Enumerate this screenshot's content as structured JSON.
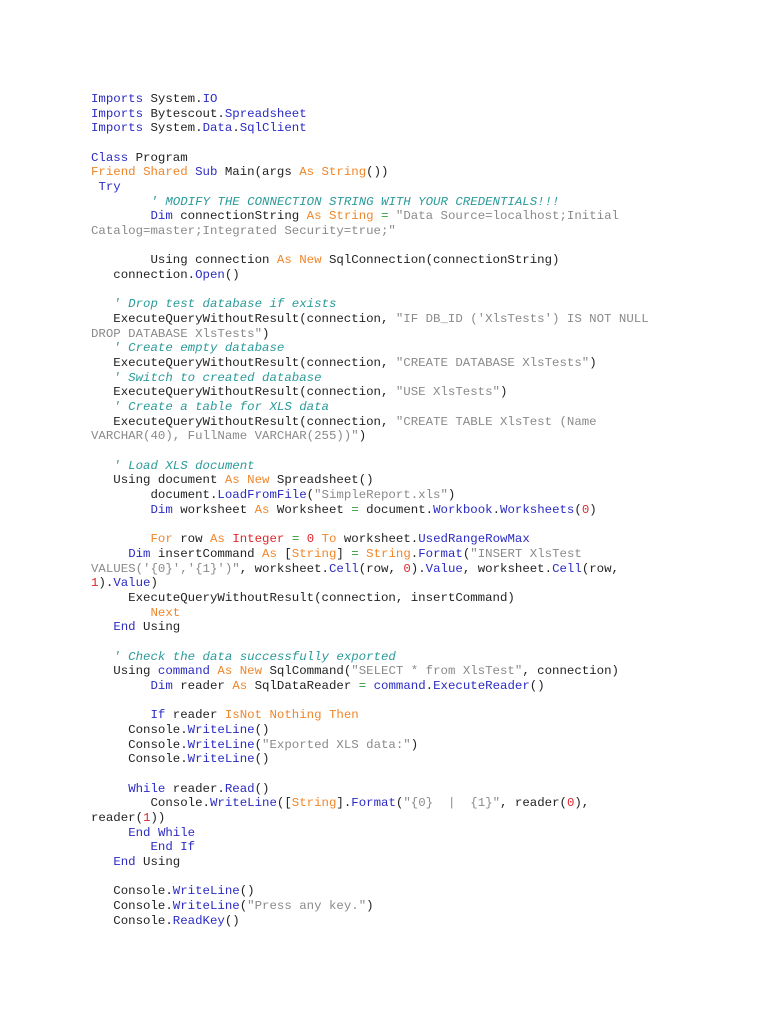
{
  "document": {
    "lines": [
      [
        [
          "Imports",
          "k"
        ],
        [
          " System.",
          "p"
        ],
        [
          "IO",
          "k"
        ]
      ],
      [
        [
          "Imports",
          "k"
        ],
        [
          " Bytescout.",
          "p"
        ],
        [
          "Spreadsheet",
          "k"
        ]
      ],
      [
        [
          "Imports",
          "k"
        ],
        [
          " System.",
          "p"
        ],
        [
          "Data",
          "k"
        ],
        [
          ".",
          "p"
        ],
        [
          "SqlClient",
          "k"
        ]
      ],
      [],
      [
        [
          "Class",
          "k"
        ],
        [
          " Program",
          "p"
        ]
      ],
      [
        [
          "Friend",
          "o"
        ],
        [
          " ",
          "p"
        ],
        [
          "Shared",
          "o"
        ],
        [
          " ",
          "p"
        ],
        [
          "Sub",
          "k"
        ],
        [
          " Main(args ",
          "p"
        ],
        [
          "As",
          "o"
        ],
        [
          " ",
          "p"
        ],
        [
          "String",
          "o"
        ],
        [
          "())",
          "p"
        ]
      ],
      [
        [
          " ",
          "p"
        ],
        [
          "Try",
          "k"
        ]
      ],
      [
        [
          "        ",
          "p"
        ],
        [
          "' MODIFY THE CONNECTION STRING WITH YOUR CREDENTIALS!!!",
          "c"
        ]
      ],
      [
        [
          "        ",
          "p"
        ],
        [
          "Dim",
          "k"
        ],
        [
          " connectionString ",
          "p"
        ],
        [
          "As",
          "o"
        ],
        [
          " ",
          "p"
        ],
        [
          "String",
          "o"
        ],
        [
          " ",
          "p"
        ],
        [
          "=",
          "g"
        ],
        [
          " ",
          "p"
        ],
        [
          "\"Data Source=localhost;Initial",
          "s"
        ]
      ],
      [
        [
          "Catalog=master;Integrated Security=true;\"",
          "s"
        ]
      ],
      [],
      [
        [
          "        Using connection ",
          "p"
        ],
        [
          "As",
          "o"
        ],
        [
          " ",
          "p"
        ],
        [
          "New",
          "o"
        ],
        [
          " SqlConnection(connectionString)",
          "p"
        ]
      ],
      [
        [
          "   connection.",
          "p"
        ],
        [
          "Open",
          "k"
        ],
        [
          "()",
          "p"
        ]
      ],
      [],
      [
        [
          "   ",
          "p"
        ],
        [
          "' Drop test database if exists",
          "c"
        ]
      ],
      [
        [
          "   ExecuteQueryWithoutResult(connection, ",
          "p"
        ],
        [
          "\"IF DB_ID ('XlsTests') IS NOT NULL",
          "s"
        ]
      ],
      [
        [
          "DROP DATABASE XlsTests\"",
          "s"
        ],
        [
          ")",
          "p"
        ]
      ],
      [
        [
          "   ",
          "p"
        ],
        [
          "' Create empty database",
          "c"
        ]
      ],
      [
        [
          "   ExecuteQueryWithoutResult(connection, ",
          "p"
        ],
        [
          "\"CREATE DATABASE XlsTests\"",
          "s"
        ],
        [
          ")",
          "p"
        ]
      ],
      [
        [
          "   ",
          "p"
        ],
        [
          "' Switch to created database",
          "c"
        ]
      ],
      [
        [
          "   ExecuteQueryWithoutResult(connection, ",
          "p"
        ],
        [
          "\"USE XlsTests\"",
          "s"
        ],
        [
          ")",
          "p"
        ]
      ],
      [
        [
          "   ",
          "p"
        ],
        [
          "' Create a table for XLS data",
          "c"
        ]
      ],
      [
        [
          "   ExecuteQueryWithoutResult(connection, ",
          "p"
        ],
        [
          "\"CREATE TABLE XlsTest (Name",
          "s"
        ]
      ],
      [
        [
          "VARCHAR(40), FullName VARCHAR(255))\"",
          "s"
        ],
        [
          ")",
          "p"
        ]
      ],
      [],
      [
        [
          "   ",
          "p"
        ],
        [
          "' Load XLS document",
          "c"
        ]
      ],
      [
        [
          "   Using document ",
          "p"
        ],
        [
          "As",
          "o"
        ],
        [
          " ",
          "p"
        ],
        [
          "New",
          "o"
        ],
        [
          " Spreadsheet()",
          "p"
        ]
      ],
      [
        [
          "        document.",
          "p"
        ],
        [
          "LoadFromFile",
          "k"
        ],
        [
          "(",
          "p"
        ],
        [
          "\"SimpleReport.xls\"",
          "s"
        ],
        [
          ")",
          "p"
        ]
      ],
      [
        [
          "        ",
          "p"
        ],
        [
          "Dim",
          "k"
        ],
        [
          " worksheet ",
          "p"
        ],
        [
          "As",
          "o"
        ],
        [
          " Worksheet ",
          "p"
        ],
        [
          "=",
          "g"
        ],
        [
          " document.",
          "p"
        ],
        [
          "Workbook",
          "k"
        ],
        [
          ".",
          "p"
        ],
        [
          "Worksheets",
          "k"
        ],
        [
          "(",
          "p"
        ],
        [
          "0",
          "r"
        ],
        [
          ")",
          "p"
        ]
      ],
      [],
      [
        [
          "        ",
          "p"
        ],
        [
          "For",
          "o"
        ],
        [
          " row ",
          "p"
        ],
        [
          "As",
          "o"
        ],
        [
          " ",
          "p"
        ],
        [
          "Integer",
          "r"
        ],
        [
          " ",
          "p"
        ],
        [
          "=",
          "g"
        ],
        [
          " ",
          "p"
        ],
        [
          "0",
          "r"
        ],
        [
          " ",
          "p"
        ],
        [
          "To",
          "o"
        ],
        [
          " worksheet.",
          "p"
        ],
        [
          "UsedRangeRowMax",
          "k"
        ]
      ],
      [
        [
          "     ",
          "p"
        ],
        [
          "Dim",
          "k"
        ],
        [
          " insertCommand ",
          "p"
        ],
        [
          "As",
          "o"
        ],
        [
          " [",
          "p"
        ],
        [
          "String",
          "o"
        ],
        [
          "] ",
          "p"
        ],
        [
          "=",
          "g"
        ],
        [
          " ",
          "p"
        ],
        [
          "String",
          "o"
        ],
        [
          ".",
          "p"
        ],
        [
          "Format",
          "k"
        ],
        [
          "(",
          "p"
        ],
        [
          "\"INSERT XlsTest",
          "s"
        ]
      ],
      [
        [
          "VALUES('{0}','{1}')\"",
          "s"
        ],
        [
          ", worksheet.",
          "p"
        ],
        [
          "Cell",
          "k"
        ],
        [
          "(row, ",
          "p"
        ],
        [
          "0",
          "r"
        ],
        [
          ").",
          "p"
        ],
        [
          "Value",
          "k"
        ],
        [
          ", worksheet.",
          "p"
        ],
        [
          "Cell",
          "k"
        ],
        [
          "(row,",
          "p"
        ]
      ],
      [
        [
          "1",
          "r"
        ],
        [
          ").",
          "p"
        ],
        [
          "Value",
          "k"
        ],
        [
          ")",
          "p"
        ]
      ],
      [
        [
          "     ExecuteQueryWithoutResult(connection, insertCommand)",
          "p"
        ]
      ],
      [
        [
          "        ",
          "p"
        ],
        [
          "Next",
          "o"
        ]
      ],
      [
        [
          "   ",
          "p"
        ],
        [
          "End",
          "k"
        ],
        [
          " Using",
          "p"
        ]
      ],
      [],
      [
        [
          "   ",
          "p"
        ],
        [
          "' Check the data successfully exported",
          "c"
        ]
      ],
      [
        [
          "   Using ",
          "p"
        ],
        [
          "command",
          "k"
        ],
        [
          " ",
          "p"
        ],
        [
          "As",
          "o"
        ],
        [
          " ",
          "p"
        ],
        [
          "New",
          "o"
        ],
        [
          " SqlCommand(",
          "p"
        ],
        [
          "\"SELECT * from XlsTest\"",
          "s"
        ],
        [
          ", connection)",
          "p"
        ]
      ],
      [
        [
          "        ",
          "p"
        ],
        [
          "Dim",
          "k"
        ],
        [
          " reader ",
          "p"
        ],
        [
          "As",
          "o"
        ],
        [
          " SqlDataReader ",
          "p"
        ],
        [
          "=",
          "g"
        ],
        [
          " ",
          "p"
        ],
        [
          "command",
          "k"
        ],
        [
          ".",
          "p"
        ],
        [
          "ExecuteReader",
          "k"
        ],
        [
          "()",
          "p"
        ]
      ],
      [],
      [
        [
          "        ",
          "p"
        ],
        [
          "If",
          "k"
        ],
        [
          " reader ",
          "p"
        ],
        [
          "IsNot",
          "o"
        ],
        [
          " ",
          "p"
        ],
        [
          "Nothing",
          "o"
        ],
        [
          " ",
          "p"
        ],
        [
          "Then",
          "o"
        ]
      ],
      [
        [
          "     Console.",
          "p"
        ],
        [
          "WriteLine",
          "k"
        ],
        [
          "()",
          "p"
        ]
      ],
      [
        [
          "     Console.",
          "p"
        ],
        [
          "WriteLine",
          "k"
        ],
        [
          "(",
          "p"
        ],
        [
          "\"Exported XLS data:\"",
          "s"
        ],
        [
          ")",
          "p"
        ]
      ],
      [
        [
          "     Console.",
          "p"
        ],
        [
          "WriteLine",
          "k"
        ],
        [
          "()",
          "p"
        ]
      ],
      [],
      [
        [
          "     ",
          "p"
        ],
        [
          "While",
          "k"
        ],
        [
          " reader.",
          "p"
        ],
        [
          "Read",
          "k"
        ],
        [
          "()",
          "p"
        ]
      ],
      [
        [
          "        Console.",
          "p"
        ],
        [
          "WriteLine",
          "k"
        ],
        [
          "([",
          "p"
        ],
        [
          "String",
          "o"
        ],
        [
          "].",
          "p"
        ],
        [
          "Format",
          "k"
        ],
        [
          "(",
          "p"
        ],
        [
          "\"{0}  |  {1}\"",
          "s"
        ],
        [
          ", reader(",
          "p"
        ],
        [
          "0",
          "r"
        ],
        [
          "),",
          "p"
        ]
      ],
      [
        [
          "reader(",
          "p"
        ],
        [
          "1",
          "r"
        ],
        [
          "))",
          "p"
        ]
      ],
      [
        [
          "     ",
          "p"
        ],
        [
          "End",
          "k"
        ],
        [
          " ",
          "p"
        ],
        [
          "While",
          "k"
        ]
      ],
      [
        [
          "        ",
          "p"
        ],
        [
          "End",
          "k"
        ],
        [
          " ",
          "p"
        ],
        [
          "If",
          "k"
        ]
      ],
      [
        [
          "   ",
          "p"
        ],
        [
          "End",
          "k"
        ],
        [
          " Using",
          "p"
        ]
      ],
      [],
      [
        [
          "   Console.",
          "p"
        ],
        [
          "WriteLine",
          "k"
        ],
        [
          "()",
          "p"
        ]
      ],
      [
        [
          "   Console.",
          "p"
        ],
        [
          "WriteLine",
          "k"
        ],
        [
          "(",
          "p"
        ],
        [
          "\"Press any key.\"",
          "s"
        ],
        [
          ")",
          "p"
        ]
      ],
      [
        [
          "   Console.",
          "p"
        ],
        [
          "ReadKey",
          "k"
        ],
        [
          "()",
          "p"
        ]
      ]
    ]
  },
  "colors": {
    "keyword": "#2b2bc4",
    "keyword_alt": "#f0862a",
    "number": "#e0252a",
    "comment": "#2b9a9a",
    "string": "#8a8a8a",
    "operator": "#2f9a3a",
    "text": "#222222"
  }
}
